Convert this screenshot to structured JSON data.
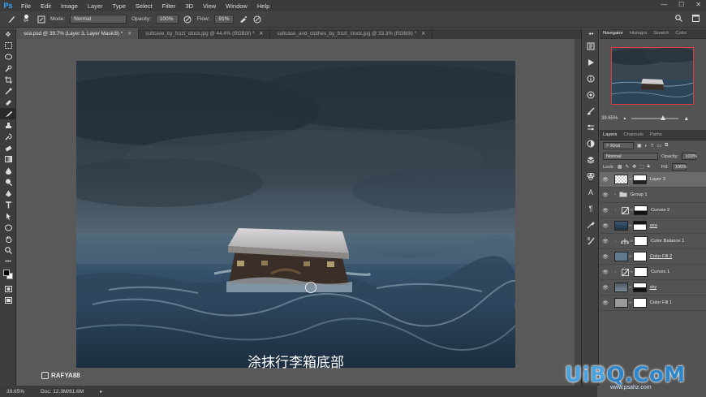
{
  "app": {
    "logo": "Ps"
  },
  "menu": [
    "File",
    "Edit",
    "Image",
    "Layer",
    "Type",
    "Select",
    "Filter",
    "3D",
    "View",
    "Window",
    "Help"
  ],
  "window_controls": [
    "—",
    "☐",
    "✕"
  ],
  "options": {
    "brush_size": "64",
    "mode_label": "Mode:",
    "mode_value": "Normal",
    "opacity_label": "Opacity:",
    "opacity_value": "100%",
    "flow_label": "Flow:",
    "flow_value": "91%"
  },
  "tabs": [
    {
      "label": "sea.psd @ 39.7% (Layer 3, Layer Mask/8) *",
      "active": true
    },
    {
      "label": "suitcase_by_frozt_stock.jpg @ 44.4% (RGB/8) *",
      "active": false
    },
    {
      "label": "suitcase_and_clothes_by_frozt_stock.jpg @ 33.3% (RGB/8) *",
      "active": false
    }
  ],
  "canvas": {
    "subtitle": "涂抹行李箱底部",
    "watermark": "RAFYA88"
  },
  "navigator": {
    "tabs": [
      "Navigator",
      "Histogra",
      "Swatch",
      "Color"
    ],
    "zoom": "39.65%"
  },
  "layers_panel": {
    "tabs": [
      "Layers",
      "Channels",
      "Paths"
    ],
    "kind_label": "Kind",
    "blend_mode": "Normal",
    "opacity_label": "Opacity:",
    "opacity_value": "100%",
    "lock_label": "Lock:",
    "fill_label": "Fill:",
    "fill_value": "100%",
    "layers": [
      {
        "name": "Layer 3",
        "type": "pixel-mask",
        "selected": true
      },
      {
        "name": "Group 1",
        "type": "group",
        "selected": false
      },
      {
        "name": "Curves 2",
        "type": "curves",
        "selected": false
      },
      {
        "name": "sea",
        "type": "pixel-mask",
        "selected": false
      },
      {
        "name": "Color Balance 1",
        "type": "balance",
        "selected": false
      },
      {
        "name": "Color Fill 2",
        "type": "fill",
        "selected": false
      },
      {
        "name": "Curves 1",
        "type": "curves",
        "selected": false
      },
      {
        "name": "sky",
        "type": "pixel-mask",
        "selected": false
      },
      {
        "name": "Color Fill 1",
        "type": "fill",
        "selected": false
      }
    ]
  },
  "status": {
    "zoom": "39.65%",
    "doc": "Doc: 12.3M/61.6M"
  },
  "site_watermark": {
    "brand_a": "UiB",
    "brand_b": "Q.CoM",
    "url": "www.psahz.com"
  }
}
